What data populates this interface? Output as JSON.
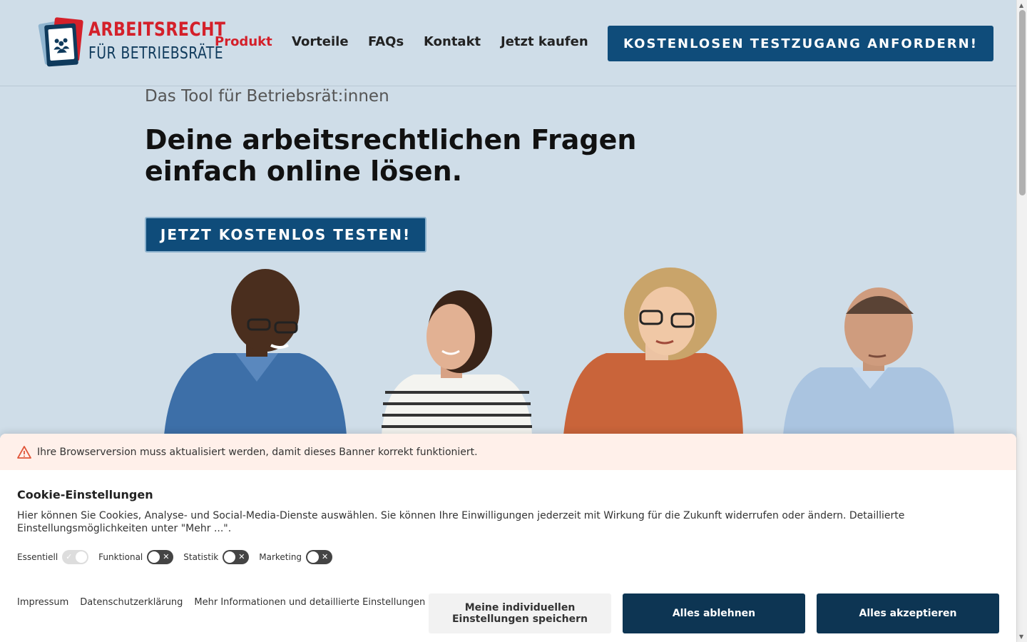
{
  "header": {
    "logo": {
      "line1": "ARBEITSRECHT",
      "line2": "FÜR BETRIEBSRÄTE"
    },
    "nav": [
      {
        "label": "Produkt",
        "active": true
      },
      {
        "label": "Vorteile",
        "active": false
      },
      {
        "label": "FAQs",
        "active": false
      },
      {
        "label": "Kontakt",
        "active": false
      },
      {
        "label": "Jetzt kaufen",
        "active": false
      }
    ],
    "cta_label": "KOSTENLOSEN TESTZUGANG ANFORDERN!"
  },
  "hero": {
    "subtitle": "Das Tool für Betriebsrät:innen",
    "title": "Deine arbeitsrechtlichen Fragen einfach online lösen.",
    "cta_label": "JETZT KOSTENLOS TESTEN!"
  },
  "cookie_banner": {
    "warning_icon": "warning-triangle-icon",
    "warning_text": "Ihre Browserversion muss aktualisiert werden, damit dieses Banner korrekt funktioniert.",
    "title": "Cookie-Einstellungen",
    "text": "Hier können Sie Cookies, Analyse- und Social-Media-Dienste auswählen. Sie können Ihre Einwilligungen jederzeit mit Wirkung für die Zukunft widerrufen oder ändern. Detaillierte Einstellungsmöglichkeiten unter \"Mehr ...\".",
    "toggles": [
      {
        "label": "Essentiell",
        "on": true,
        "disabled": true
      },
      {
        "label": "Funktional",
        "on": false,
        "disabled": false
      },
      {
        "label": "Statistik",
        "on": false,
        "disabled": false
      },
      {
        "label": "Marketing",
        "on": false,
        "disabled": false
      }
    ],
    "links": {
      "impressum": "Impressum",
      "datenschutz": "Datenschutzerklärung",
      "mehr": "Mehr Informationen und detaillierte Einstellungen"
    },
    "buttons": {
      "save": "Meine individuellen Einstellungen speichern",
      "reject": "Alles ablehnen",
      "accept": "Alles akzeptieren"
    }
  },
  "colors": {
    "background": "#cfdde8",
    "brand_blue": "#0f4c7a",
    "brand_red": "#d4202a",
    "cookie_dark": "#0d3553"
  }
}
